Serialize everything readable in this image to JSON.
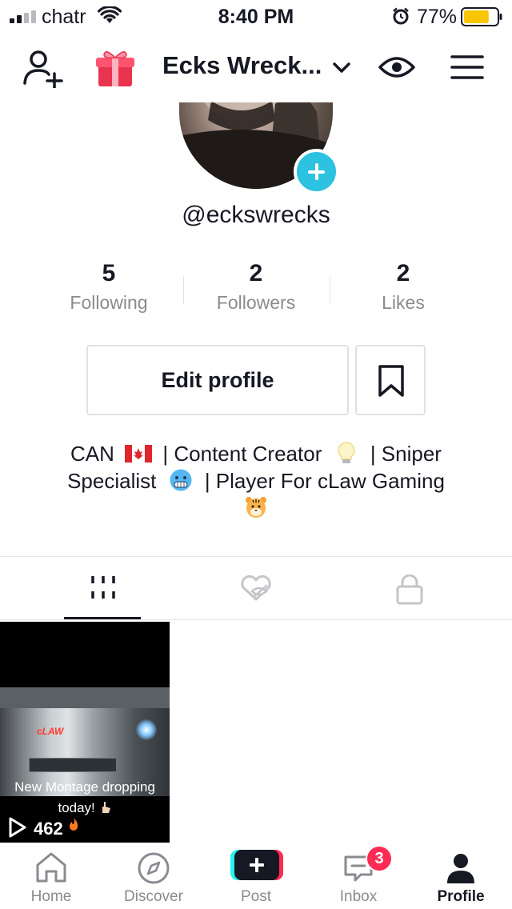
{
  "status_bar": {
    "carrier": "chatr",
    "time": "8:40 PM",
    "battery_percent": "77%",
    "battery_level": 0.77,
    "battery_color": "#f7c600"
  },
  "header": {
    "title": "Ecks Wreck...",
    "icons": [
      "add-user-icon",
      "gift-icon",
      "chevron-down-icon",
      "eye-icon",
      "hamburger-menu-icon"
    ]
  },
  "profile": {
    "handle": "@eckswrecks",
    "stats": [
      {
        "value": "5",
        "label": "Following"
      },
      {
        "value": "2",
        "label": "Followers"
      },
      {
        "value": "2",
        "label": "Likes"
      }
    ],
    "edit_button": "Edit profile",
    "bio": {
      "line1": {
        "a": "CAN",
        "b": "| Content Creator",
        "c": "| Sniper"
      },
      "line2": {
        "a": "Specialist",
        "b": "| Player For cLaw Gaming"
      }
    }
  },
  "tabs": [
    "videos-grid-icon",
    "liked-hidden-icon",
    "private-lock-icon"
  ],
  "videos": [
    {
      "caption": "New Montage dropping today!",
      "views": "462",
      "overlay_logo": "cLAW"
    }
  ],
  "nav": {
    "items": [
      {
        "label": "Home",
        "icon": "home-icon"
      },
      {
        "label": "Discover",
        "icon": "compass-icon"
      },
      {
        "label": "Post",
        "icon": "plus-icon"
      },
      {
        "label": "Inbox",
        "icon": "inbox-icon"
      },
      {
        "label": "Profile",
        "icon": "person-icon"
      }
    ],
    "inbox_badge": "3",
    "active": "Profile"
  },
  "colors": {
    "accent_cyan": "#2dc2e0",
    "brand_red": "#fe2c55",
    "brand_teal": "#25f4ee",
    "text": "#161823",
    "muted": "#8a8b91"
  }
}
